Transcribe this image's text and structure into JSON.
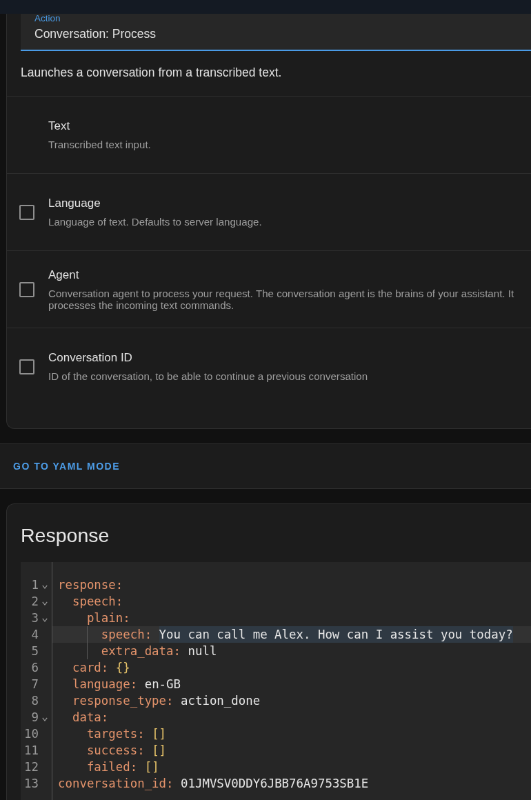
{
  "action_field": {
    "label": "Action",
    "value": "Conversation: Process"
  },
  "description": "Launches a conversation from a transcribed text.",
  "fields": [
    {
      "kind": "required",
      "label": "Text",
      "description": "Transcribed text input."
    },
    {
      "kind": "optional",
      "checked": false,
      "label": "Language",
      "description": "Language of text. Defaults to server language."
    },
    {
      "kind": "optional",
      "checked": false,
      "label": "Agent",
      "description": "Conversation agent to process your request. The conversation agent is the brains of your assistant. It processes the incoming text commands."
    },
    {
      "kind": "optional",
      "checked": false,
      "label": "Conversation ID",
      "description": "ID of the conversation, to be able to continue a previous conversation"
    }
  ],
  "yaml_button": "GO TO YAML MODE",
  "response": {
    "title": "Response",
    "lines": [
      {
        "number": "1",
        "kind": "mapping",
        "key": "response:",
        "expanded": true,
        "active": false,
        "children": [
          {
            "number": "2",
            "kind": "mapping",
            "key": "speech:",
            "expanded": true,
            "active": false,
            "children": [
              {
                "number": "3",
                "kind": "mapping",
                "key": "plain:",
                "expanded": true,
                "active": false,
                "children": [
                  {
                    "number": "4",
                    "kind": "scalar",
                    "key": "speech:",
                    "value": "You can call me Alex. How can I assist you today?",
                    "active": true,
                    "selected": true
                  },
                  {
                    "number": "5",
                    "kind": "scalar",
                    "key": "extra_data:",
                    "value": "null",
                    "active": false,
                    "selected": false
                  }
                ]
              }
            ]
          },
          {
            "number": "6",
            "kind": "collection",
            "key": "card:",
            "value": "{}",
            "active": false,
            "selected": false
          },
          {
            "number": "7",
            "kind": "scalar",
            "key": "language:",
            "value": "en-GB",
            "active": false,
            "selected": false
          },
          {
            "number": "8",
            "kind": "scalar",
            "key": "response_type:",
            "value": "action_done",
            "active": false,
            "selected": false
          },
          {
            "number": "9",
            "kind": "mapping",
            "key": "data:",
            "expanded": true,
            "active": false,
            "children": [
              {
                "number": "10",
                "kind": "collection",
                "key": "targets:",
                "value": "[]",
                "active": false,
                "selected": false
              },
              {
                "number": "11",
                "kind": "collection",
                "key": "success:",
                "value": "[]",
                "active": false,
                "selected": false
              },
              {
                "number": "12",
                "kind": "collection",
                "key": "failed:",
                "value": "[]",
                "active": false,
                "selected": false
              }
            ]
          }
        ]
      },
      {
        "number": "13",
        "kind": "scalar",
        "key": "conversation_id:",
        "value": "01JMVSV0DDY6JBB76A9753SB1E",
        "active": false,
        "selected": false
      }
    ]
  }
}
